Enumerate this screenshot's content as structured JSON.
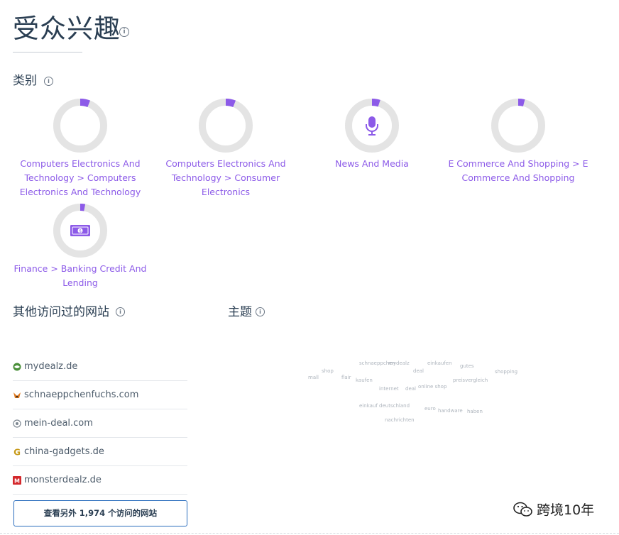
{
  "page": {
    "title": "受众兴趣"
  },
  "categories_section": {
    "heading": "类别",
    "items": [
      {
        "label": "Computers Electronics And Technology > Computers Electronics And Technology",
        "share": 0.06
      },
      {
        "label": "Computers Electronics And Technology > Consumer Electronics",
        "share": 0.06
      },
      {
        "label": "News And Media",
        "share": 0.05,
        "icon": "microphone-icon"
      },
      {
        "label": "E Commerce And Shopping > E Commerce And Shopping",
        "share": 0.04
      },
      {
        "label": "Finance > Banking Credit And Lending",
        "share": 0.03,
        "icon": "banknote-icon"
      }
    ],
    "accent_color": "#8c5ae8",
    "track_color": "#e4e4e4"
  },
  "other_sites": {
    "heading": "其他访问过的网站",
    "items": [
      {
        "name": "mydealz.de",
        "icon": "mydealz-favicon"
      },
      {
        "name": "schnaeppchenfuchs.com",
        "icon": "fox-favicon"
      },
      {
        "name": "mein-deal.com",
        "icon": "mein-deal-favicon"
      },
      {
        "name": "china-gadgets.de",
        "icon": "g-favicon"
      },
      {
        "name": "monsterdealz.de",
        "icon": "m-favicon"
      }
    ],
    "see_more_label": "查看另外 1,974 个访问的网站"
  },
  "topics": {
    "heading": "主题",
    "words": [
      "schnaeppchen",
      "mydealz",
      "einkaufen",
      "gutes",
      "shop",
      "deal",
      "shopping",
      "mall",
      "flair",
      "kaufen",
      "preisvergleich",
      "internet",
      "deal",
      "online shop",
      "einkauf deutschland",
      "euro",
      "handware",
      "haben",
      "nachrichten"
    ]
  },
  "watermark": {
    "text": "跨境10年"
  }
}
